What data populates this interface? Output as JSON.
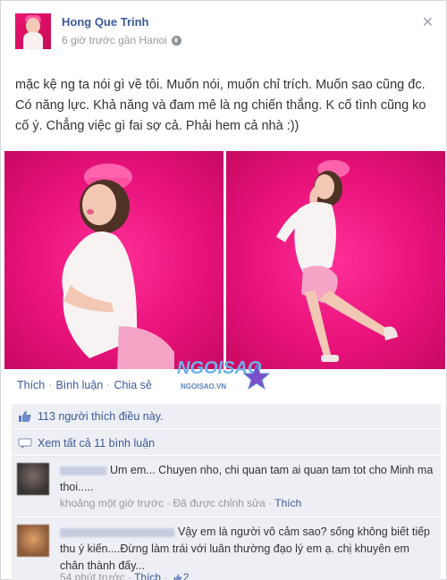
{
  "post": {
    "author": "Hong Que Trinh",
    "time_location": "6 giờ trước gần Hanoi",
    "status_text": "mặc kệ ng ta nói gì về tôi. Muốn nói, muốn chỉ trích. Muốn sao cũng đc. Có năng lực. Khả năng và đam mê là ng chiến thắng. K cố tình cũng ko cố ý. Chẳng việc gì fai sợ cả. Phải hem cả nhà :))",
    "close_glyph": "✕"
  },
  "actions": {
    "like": "Thích",
    "comment": "Bình luận",
    "share": "Chia sẻ",
    "sep": "·"
  },
  "watermark": {
    "brand": "NGOISAO",
    "domain": "NGOISAO.VN"
  },
  "likes": {
    "text": "113 người thích điều này."
  },
  "view_all": {
    "text": "Xem tất cả 11 bình luận"
  },
  "comments": [
    {
      "text": "Um em... Chuyen nho, chi quan tam ai quan tam tot cho Minh ma thoi.....",
      "time": "khoảng một giờ trước",
      "edited": "Đã được chỉnh sửa",
      "like": "Thích",
      "sep": "·"
    },
    {
      "text": "Vậy em là người vô cảm sao? sống không biết tiếp thu ý kiến....Đừng làm trái với luân thường đạo lý em ạ. chị khuyên em chân thành đấy...",
      "time": "54 phút trước",
      "like": "Thích",
      "like_count": "2",
      "sep": "·"
    }
  ],
  "colors": {
    "link": "#3b5998",
    "muted": "#999999",
    "comment_bg": "#edeff4",
    "photo_pink": "#e8127a"
  },
  "icons": {
    "privacy": "globe-icon",
    "close": "close-icon",
    "likes": "thumbs-up-icon",
    "comments": "comment-bubble-icon"
  }
}
